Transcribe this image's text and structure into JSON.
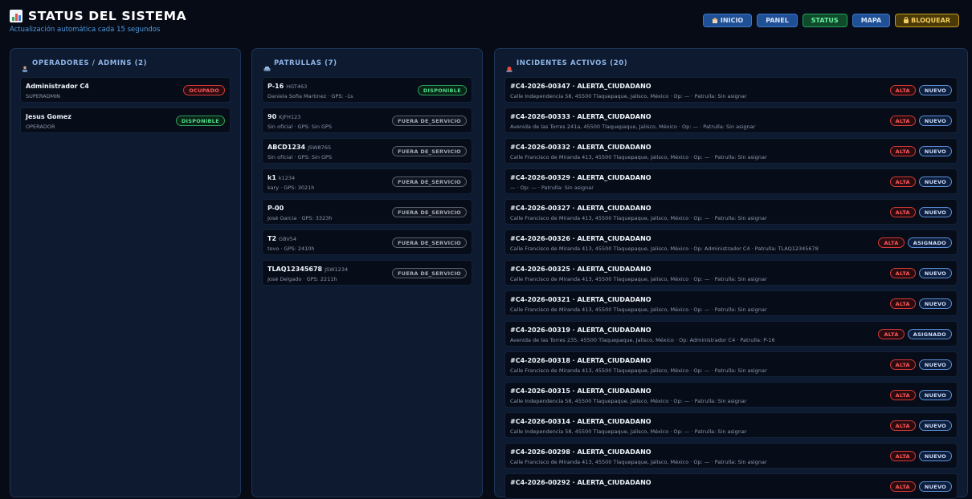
{
  "header": {
    "title": "STATUS DEL SISTEMA",
    "subtitle": "Actualización automática cada 15 segundos",
    "nav": [
      "INICIO",
      "PANEL",
      "STATUS",
      "MAPA",
      "BLOQUEAR"
    ]
  },
  "operators": {
    "title": "OPERADORES / ADMINS (2)",
    "items": [
      {
        "name": "Administrador C4",
        "role": "SUPERADMIN",
        "status": "OCUPADO"
      },
      {
        "name": "Jesus Gomez",
        "role": "OPERADOR",
        "status": "DISPONIBLE"
      }
    ]
  },
  "patrols": {
    "title": "PATRULLAS (7)",
    "items": [
      {
        "name": "P-16",
        "plate": "HGT463",
        "detail": "Daniela Sofia Martinez · GPS: -1s",
        "status": "DISPONIBLE"
      },
      {
        "name": "90",
        "plate": "KJFH123",
        "detail": "Sin oficial · GPS: Sin GPS",
        "status": "FUERA DE_SERVICIO"
      },
      {
        "name": "ABCD1234",
        "plate": "JSW8765",
        "detail": "Sin oficial · GPS: Sin GPS",
        "status": "FUERA DE_SERVICIO"
      },
      {
        "name": "k1",
        "plate": "k1234",
        "detail": "kary · GPS: 3021h",
        "status": "FUERA DE_SERVICIO"
      },
      {
        "name": "P-00",
        "plate": "",
        "detail": "José Garcia · GPS: 3323h",
        "status": "FUERA DE_SERVICIO"
      },
      {
        "name": "T2",
        "plate": "GBV54",
        "detail": "tovo · GPS: 2410h",
        "status": "FUERA DE_SERVICIO"
      },
      {
        "name": "TLAQ12345678",
        "plate": "JSW1234",
        "detail": "José Delgado · GPS: 2211h",
        "status": "FUERA DE_SERVICIO"
      }
    ]
  },
  "incidents": {
    "title": "INCIDENTES ACTIVOS (20)",
    "items": [
      {
        "title": "#C4-2026-00347 · ALERTA_CIUDADANO",
        "detail": "Calle Independencia 58, 45500 Tlaquepaque, Jalisco, México · Op: — · Patrulla: Sin asignar",
        "priority": "ALTA",
        "state": "NUEVO"
      },
      {
        "title": "#C4-2026-00333 · ALERTA_CIUDADANO",
        "detail": "Avenida de las Torres 241a, 45500 Tlaquepaque, Jalisco, México · Op: — · Patrulla: Sin asignar",
        "priority": "ALTA",
        "state": "NUEVO"
      },
      {
        "title": "#C4-2026-00332 · ALERTA_CIUDADANO",
        "detail": "Calle Francisco de Miranda 413, 45500 Tlaquepaque, Jalisco, México · Op: — · Patrulla: Sin asignar",
        "priority": "ALTA",
        "state": "NUEVO"
      },
      {
        "title": "#C4-2026-00329 · ALERTA_CIUDADANO",
        "detail": "— · Op: — · Patrulla: Sin asignar",
        "priority": "ALTA",
        "state": "NUEVO"
      },
      {
        "title": "#C4-2026-00327 · ALERTA_CIUDADANO",
        "detail": "Calle Francisco de Miranda 413, 45500 Tlaquepaque, Jalisco, México · Op: — · Patrulla: Sin asignar",
        "priority": "ALTA",
        "state": "NUEVO"
      },
      {
        "title": "#C4-2026-00326 · ALERTA_CIUDADANO",
        "detail": "Calle Francisco de Miranda 413, 45500 Tlaquepaque, Jalisco, México · Op: Administrador C4 · Patrulla: TLAQ12345678",
        "priority": "ALTA",
        "state": "ASIGNADO"
      },
      {
        "title": "#C4-2026-00325 · ALERTA_CIUDADANO",
        "detail": "Calle Francisco de Miranda 413, 45500 Tlaquepaque, Jalisco, México · Op: — · Patrulla: Sin asignar",
        "priority": "ALTA",
        "state": "NUEVO"
      },
      {
        "title": "#C4-2026-00321 · ALERTA_CIUDADANO",
        "detail": "Calle Francisco de Miranda 413, 45500 Tlaquepaque, Jalisco, México · Op: — · Patrulla: Sin asignar",
        "priority": "ALTA",
        "state": "NUEVO"
      },
      {
        "title": "#C4-2026-00319 · ALERTA_CIUDADANO",
        "detail": "Avenida de las Torres 235, 45500 Tlaquepaque, Jalisco, México · Op: Administrador C4 · Patrulla: P-16",
        "priority": "ALTA",
        "state": "ASIGNADO"
      },
      {
        "title": "#C4-2026-00318 · ALERTA_CIUDADANO",
        "detail": "Calle Francisco de Miranda 413, 45500 Tlaquepaque, Jalisco, México · Op: — · Patrulla: Sin asignar",
        "priority": "ALTA",
        "state": "NUEVO"
      },
      {
        "title": "#C4-2026-00315 · ALERTA_CIUDADANO",
        "detail": "Calle Independencia 58, 45500 Tlaquepaque, Jalisco, México · Op: — · Patrulla: Sin asignar",
        "priority": "ALTA",
        "state": "NUEVO"
      },
      {
        "title": "#C4-2026-00314 · ALERTA_CIUDADANO",
        "detail": "Calle Independencia 58, 45500 Tlaquepaque, Jalisco, México · Op: — · Patrulla: Sin asignar",
        "priority": "ALTA",
        "state": "NUEVO"
      },
      {
        "title": "#C4-2026-00298 · ALERTA_CIUDADANO",
        "detail": "Calle Francisco de Miranda 413, 45500 Tlaquepaque, Jalisco, México · Op: — · Patrulla: Sin asignar",
        "priority": "ALTA",
        "state": "NUEVO"
      },
      {
        "title": "#C4-2026-00292 · ALERTA_CIUDADANO",
        "detail": "",
        "priority": "ALTA",
        "state": "NUEVO"
      }
    ]
  },
  "colors": {
    "accent": "#4e9be0",
    "alert": "#ff5a5a",
    "ok": "#4fe089",
    "panel": "#0d1a30",
    "background": "#070b16"
  }
}
